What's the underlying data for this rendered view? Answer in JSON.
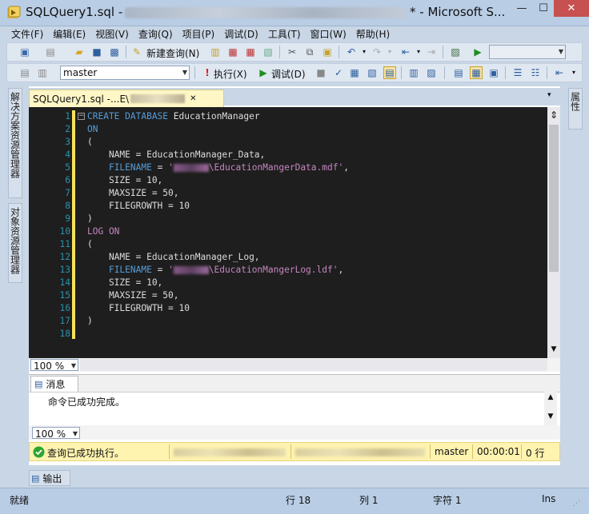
{
  "window": {
    "title_prefix": "SQLQuery1.sql - ",
    "title_suffix": "* - Microsoft S...",
    "min_glyph": "—",
    "max_glyph": "☐",
    "close_glyph": "✕"
  },
  "menu": [
    "文件(F)",
    "编辑(E)",
    "视图(V)",
    "查询(Q)",
    "项目(P)",
    "调试(D)",
    "工具(T)",
    "窗口(W)",
    "帮助(H)"
  ],
  "toolbar1": {
    "new_query_label": "新建查询(N)"
  },
  "toolbar2": {
    "database": "master",
    "execute_label": "执行(X)",
    "debug_label": "调试(D)"
  },
  "side_tabs": {
    "solution_explorer": "解决方案资源管理器",
    "object_explorer": "对象资源管理器",
    "properties": "属性"
  },
  "document_tab": {
    "label_prefix": "SQLQuery1.sql -...E\\",
    "close_glyph": "✕",
    "pin_glyph": "▾"
  },
  "editor": {
    "lines": [
      {
        "n": "1",
        "parts": [
          {
            "t": "CREATE DATABASE",
            "c": "kw"
          },
          {
            "t": " EducationManager",
            "c": ""
          }
        ]
      },
      {
        "n": "2",
        "parts": [
          {
            "t": "ON",
            "c": "kw"
          }
        ]
      },
      {
        "n": "3",
        "parts": [
          {
            "t": "(",
            "c": ""
          }
        ]
      },
      {
        "n": "4",
        "parts": [
          {
            "t": "    NAME = EducationManager_Data,",
            "c": ""
          }
        ]
      },
      {
        "n": "5",
        "parts": [
          {
            "t": "    ",
            "c": ""
          },
          {
            "t": "FILENAME",
            "c": "kw"
          },
          {
            "t": " = ",
            "c": ""
          },
          {
            "t": "'",
            "c": "fn"
          },
          {
            "t": "MASK",
            "c": "mask"
          },
          {
            "t": "\\EducationMangerData.mdf'",
            "c": "fn"
          },
          {
            "t": ",",
            "c": ""
          }
        ]
      },
      {
        "n": "6",
        "parts": [
          {
            "t": "    SIZE = 10,",
            "c": ""
          }
        ]
      },
      {
        "n": "7",
        "parts": [
          {
            "t": "    MAXSIZE = 50,",
            "c": ""
          }
        ]
      },
      {
        "n": "8",
        "parts": [
          {
            "t": "    FILEGROWTH = 10",
            "c": ""
          }
        ]
      },
      {
        "n": "9",
        "parts": [
          {
            "t": ")",
            "c": ""
          }
        ]
      },
      {
        "n": "10",
        "parts": [
          {
            "t": "LOG ON",
            "c": "fn"
          }
        ]
      },
      {
        "n": "11",
        "parts": [
          {
            "t": "(",
            "c": ""
          }
        ]
      },
      {
        "n": "12",
        "parts": [
          {
            "t": "    NAME = EducationManager_Log,",
            "c": ""
          }
        ]
      },
      {
        "n": "13",
        "parts": [
          {
            "t": "    ",
            "c": ""
          },
          {
            "t": "FILENAME",
            "c": "kw"
          },
          {
            "t": " = ",
            "c": ""
          },
          {
            "t": "'",
            "c": "fn"
          },
          {
            "t": "MASK",
            "c": "mask"
          },
          {
            "t": "\\EducationMangerLog.ldf'",
            "c": "fn"
          },
          {
            "t": ",",
            "c": ""
          }
        ]
      },
      {
        "n": "14",
        "parts": [
          {
            "t": "    SIZE = 10,",
            "c": ""
          }
        ]
      },
      {
        "n": "15",
        "parts": [
          {
            "t": "    MAXSIZE = 50,",
            "c": ""
          }
        ]
      },
      {
        "n": "16",
        "parts": [
          {
            "t": "    FILEGROWTH = 10",
            "c": ""
          }
        ]
      },
      {
        "n": "17",
        "parts": [
          {
            "t": ")",
            "c": ""
          }
        ]
      },
      {
        "n": "18",
        "parts": []
      }
    ]
  },
  "zoom": {
    "editor": "100 %",
    "results": "100 %"
  },
  "messages": {
    "tab_label": "消息",
    "text": "命令已成功完成。"
  },
  "query_status": {
    "message": "查询已成功执行。",
    "database": "master",
    "elapsed": "00:00:01",
    "rows": "0 行"
  },
  "output_tab": "输出",
  "statusbar": {
    "ready": "就绪",
    "line": "行 18",
    "col": "列 1",
    "char": "字符 1",
    "mode": "Ins"
  }
}
